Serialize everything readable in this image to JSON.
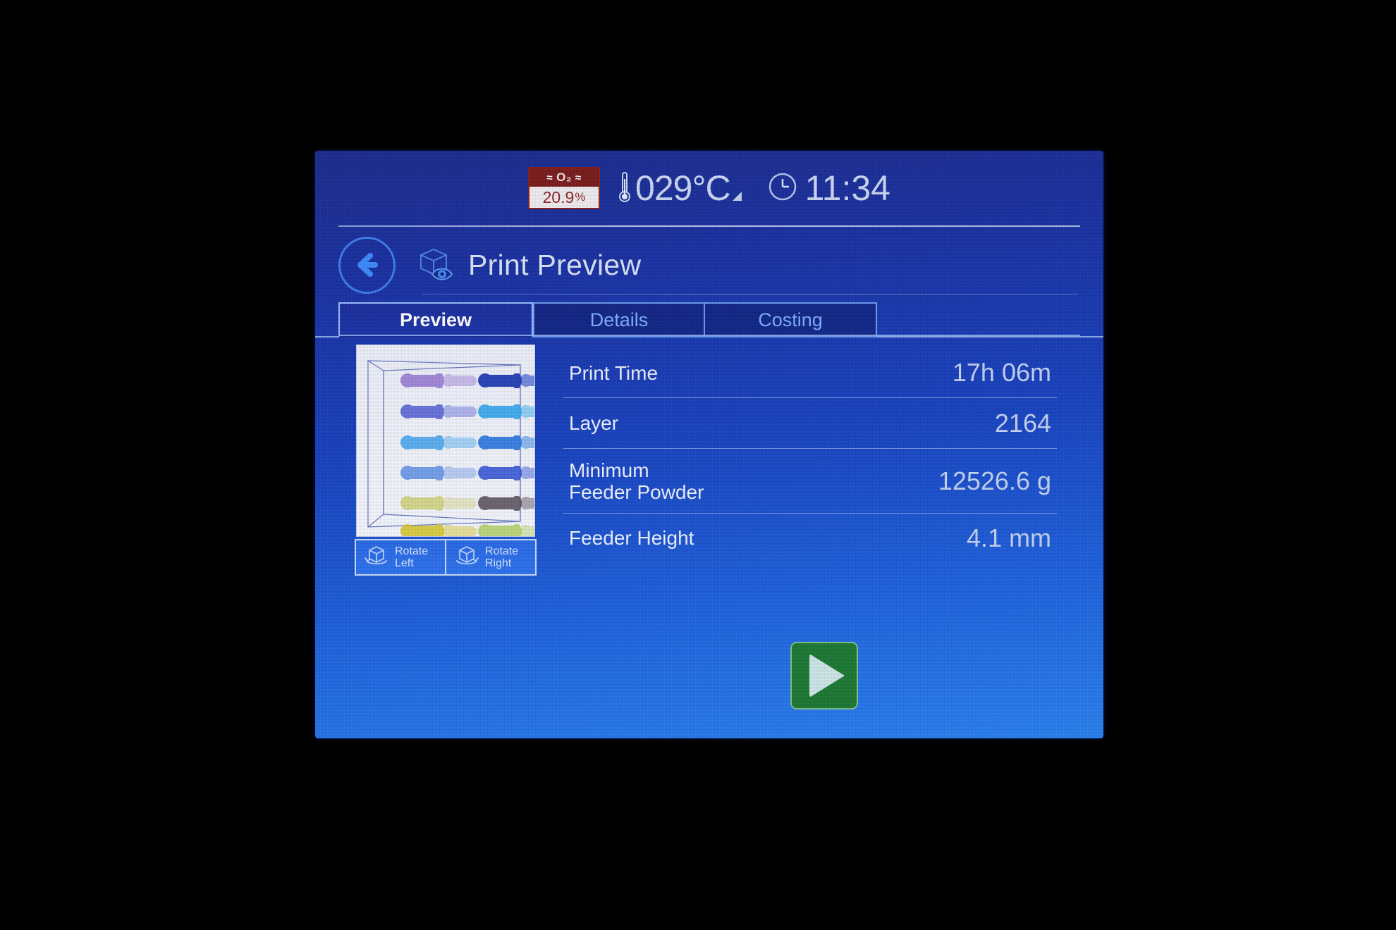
{
  "status_bar": {
    "o2_label": "O₂",
    "o2_value": "20.9",
    "o2_unit": "%",
    "o2_icon_left": "waves-icon",
    "o2_icon_right": "waves-icon",
    "temperature": "029",
    "temperature_unit": "°C",
    "temperature_icon": "thermometer-icon",
    "clock_icon": "clock-icon",
    "time": "11:34",
    "o2_header_color": "#7c1d1d",
    "o2_text_color": "#8e2626"
  },
  "header": {
    "back_icon": "back-arrow-icon",
    "title_icon": "cube-eye-icon",
    "title": "Print Preview"
  },
  "tabs": [
    {
      "label": "Preview",
      "active": true
    },
    {
      "label": "Details",
      "active": false
    },
    {
      "label": "Costing",
      "active": false
    }
  ],
  "preview": {
    "rotate_left": {
      "line1": "Rotate",
      "line2": "Left",
      "icon": "rotate-left-cube-icon"
    },
    "rotate_right": {
      "line1": "Rotate",
      "line2": "Right",
      "icon": "rotate-right-cube-icon"
    },
    "build_volume_caption": "3D build chamber with stacked parts"
  },
  "info": {
    "rows": [
      {
        "key": "Print Time",
        "value": "17h 06m"
      },
      {
        "key": "Layer",
        "value": "2164"
      },
      {
        "key": "Minimum\nFeeder Powder",
        "value": "12526.6 g"
      },
      {
        "key": "Feeder Height",
        "value": "4.1 mm"
      }
    ]
  },
  "actions": {
    "start_print_icon": "play-icon",
    "start_print_color": "#1e7a35"
  },
  "theme": {
    "screen_gradient_top": "#1e2d8f",
    "screen_gradient_bottom": "#2b82f2",
    "accent_blue": "#3e7ff0",
    "tab_active_text": "#ffffff",
    "tab_inactive_text": "#7fb0ff"
  }
}
